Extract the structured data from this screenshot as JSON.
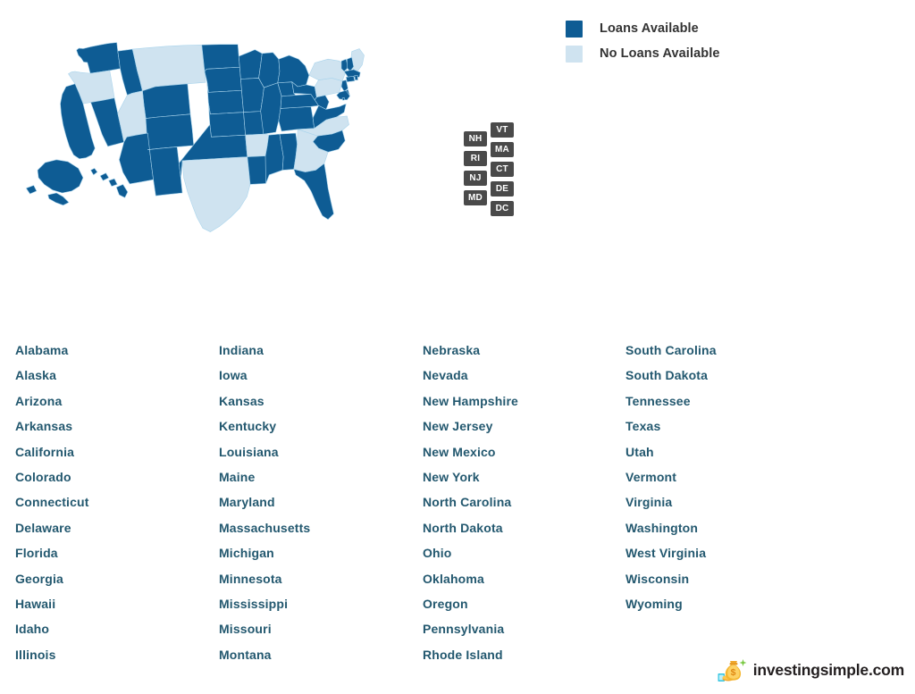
{
  "legend": {
    "items": [
      {
        "label": "Loans Available",
        "color": "#0e5c94",
        "key": "on"
      },
      {
        "label": "No Loans Available",
        "color": "#cfe3f0",
        "key": "off"
      }
    ]
  },
  "map": {
    "abbr_boxes": {
      "left_column": [
        "NH",
        "RI",
        "NJ",
        "MD"
      ],
      "right_column": [
        "VT",
        "MA",
        "CT",
        "DE",
        "DC"
      ]
    },
    "states_loans_available": [
      "AK",
      "AZ",
      "CA",
      "CO",
      "CT",
      "DC",
      "DE",
      "FL",
      "HI",
      "IA",
      "ID",
      "IL",
      "IN",
      "KS",
      "KY",
      "LA",
      "MA",
      "MD",
      "MI",
      "MN",
      "MO",
      "MS",
      "ND",
      "NE",
      "NH",
      "NJ",
      "NM",
      "NV",
      "OH",
      "OK",
      "RI",
      "SC",
      "SD",
      "TN",
      "VA",
      "VT",
      "WA",
      "WI",
      "WV",
      "WY",
      "AL"
    ],
    "states_no_loans": [
      "AR",
      "GA",
      "ME",
      "MT",
      "NC",
      "NY",
      "OR",
      "PA",
      "TX",
      "UT"
    ]
  },
  "state_list": {
    "columns": [
      [
        "Alabama",
        "Alaska",
        "Arizona",
        "Arkansas",
        "California",
        "Colorado",
        "Connecticut",
        "Delaware",
        "Florida",
        "Georgia",
        "Hawaii",
        "Idaho",
        "Illinois"
      ],
      [
        "Indiana",
        "Iowa",
        "Kansas",
        "Kentucky",
        "Louisiana",
        "Maine",
        "Maryland",
        "Massachusetts",
        "Michigan",
        "Minnesota",
        "Mississippi",
        "Missouri",
        "Montana"
      ],
      [
        "Nebraska",
        "Nevada",
        "New Hampshire",
        "New Jersey",
        "New Mexico",
        "New York",
        "North Carolina",
        "North Dakota",
        "Ohio",
        "Oklahoma",
        "Oregon",
        "Pennsylvania",
        "Rhode Island"
      ],
      [
        "South Carolina",
        "South Dakota",
        "Tennessee",
        "Texas",
        "Utah",
        "Vermont",
        "Virginia",
        "Washington",
        "West Virginia",
        "Wisconsin",
        "Wyoming"
      ]
    ]
  },
  "footer": {
    "wordmark": "investingsimple.com",
    "logo_icon": "money-bag-icon"
  },
  "colors": {
    "loans_available": "#0e5c94",
    "no_loans_available": "#cfe3f0",
    "state_name_text": "#23586f",
    "legend_text": "#333333",
    "abbr_box_bg": "#4a4a4a",
    "map_border": "#a9d4ec"
  }
}
